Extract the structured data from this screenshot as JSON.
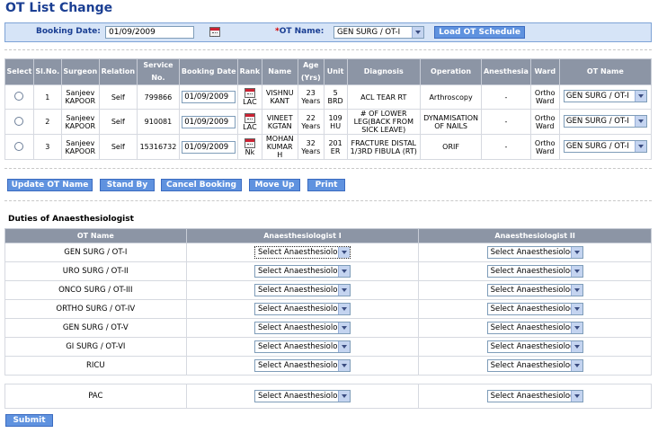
{
  "page": {
    "title": "OT List Change"
  },
  "filter": {
    "booking_date_label": "Booking Date:",
    "booking_date_value": "01/09/2009",
    "required_mark": "*",
    "ot_name_label": "OT Name:",
    "ot_name_value": "GEN SURG / OT-I",
    "load_button": "Load OT Schedule"
  },
  "schedule": {
    "columns": [
      "Select",
      "Sl.No.",
      "Surgeon",
      "Relation",
      "Service No.",
      "Booking Date",
      "Rank",
      "Name",
      "Age (Yrs)",
      "Unit",
      "Diagnosis",
      "Operation",
      "Anesthesia",
      "Ward",
      "OT Name"
    ],
    "rows": [
      {
        "sl": "1",
        "surgeon": "Sanjeev KAPOOR",
        "relation": "Self",
        "service_no": "799866",
        "booking_date": "01/09/2009",
        "rank": "LAC",
        "name": "VISHNU KANT",
        "age": "23 Years",
        "unit": "5 BRD",
        "diagnosis": "ACL TEAR RT",
        "operation": "Arthroscopy",
        "anesthesia": "-",
        "ward": "Ortho Ward",
        "ot_name": "GEN SURG / OT-I"
      },
      {
        "sl": "2",
        "surgeon": "Sanjeev KAPOOR",
        "relation": "Self",
        "service_no": "910081",
        "booking_date": "01/09/2009",
        "rank": "LAC",
        "name": "VINEET KGTAN",
        "age": "22 Years",
        "unit": "109 HU",
        "diagnosis": "# OF LOWER LEG(BACK FROM SICK LEAVE)",
        "operation": "DYNAMISATION OF NAILS",
        "anesthesia": "-",
        "ward": "Ortho Ward",
        "ot_name": "GEN SURG / OT-I"
      },
      {
        "sl": "3",
        "surgeon": "Sanjeev KAPOOR",
        "relation": "Self",
        "service_no": "15316732",
        "booking_date": "01/09/2009",
        "rank": "Nk",
        "name": "MOHAN KUMAR H",
        "age": "32 Years",
        "unit": "201 ER",
        "diagnosis": "FRACTURE DISTAL 1/3RD FIBULA (RT)",
        "operation": "ORIF",
        "anesthesia": "-",
        "ward": "Ortho Ward",
        "ot_name": "GEN SURG / OT-I"
      }
    ]
  },
  "actions": {
    "update": "Update OT Name",
    "stand_by": "Stand By",
    "cancel": "Cancel Booking",
    "move_up": "Move Up",
    "print": "Print"
  },
  "duties": {
    "title": "Duties of Anaesthesiologist",
    "columns": [
      "OT Name",
      "Anaesthesiologist I",
      "Anaesthesiologist II"
    ],
    "select_placeholder": "Select Anaesthesiologist",
    "rows": [
      "GEN SURG / OT-I",
      "URO SURG / OT-II",
      "ONCO SURG / OT-III",
      "ORTHO SURG / OT-IV",
      "GEN SURG / OT-V",
      "GI SURG / OT-VI",
      "RICU"
    ],
    "pac": "PAC"
  },
  "submit": "Submit",
  "icons": {
    "calendar": "calendar-icon",
    "dropdown": "chevron-down-icon",
    "radio": "radio-button"
  },
  "colors": {
    "title": "#1b3f93",
    "header_bg": "#8c95a5",
    "button_bg": "#5f92df",
    "panel_bg": "#d6e4f7"
  }
}
